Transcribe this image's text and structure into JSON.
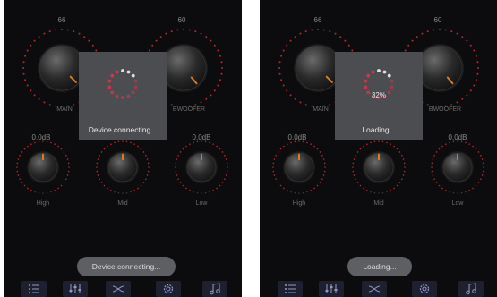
{
  "screens": [
    {
      "knobs": {
        "main": {
          "value": "66",
          "label": "MAIN"
        },
        "subwoofer": {
          "value": "60",
          "label": "BWOOFER"
        },
        "high": {
          "value": "0,0dB",
          "label": "High"
        },
        "mid": {
          "label": "Mid"
        },
        "low": {
          "value": "0,0dB",
          "label": "Low"
        }
      },
      "dialog": {
        "text": "Device connecting...",
        "percent": ""
      },
      "toast": {
        "text": "Device connecting..."
      }
    },
    {
      "knobs": {
        "main": {
          "value": "66",
          "label": "MAIN"
        },
        "subwoofer": {
          "value": "60",
          "label": "BWOOFER"
        },
        "high": {
          "value": "0,0dB",
          "label": "High"
        },
        "mid": {
          "label": "Mid"
        },
        "low": {
          "value": "0,0dB",
          "label": "Low"
        }
      },
      "dialog": {
        "text": "Loading...",
        "percent": "32%"
      },
      "toast": {
        "text": "Loading..."
      }
    }
  ],
  "nav_icons": [
    "list-icon",
    "equalizer-icon",
    "crossover-icon",
    "settings-icon",
    "music-note-icon"
  ],
  "colors": {
    "background": "#0c0c0e",
    "dial_dots": "#b52a2a",
    "knob_pointer": "#e0781e",
    "dialog_bg": "#4b4d51",
    "toast_bg": "#5e5f63",
    "nav_button_bg": "#1e2030"
  }
}
